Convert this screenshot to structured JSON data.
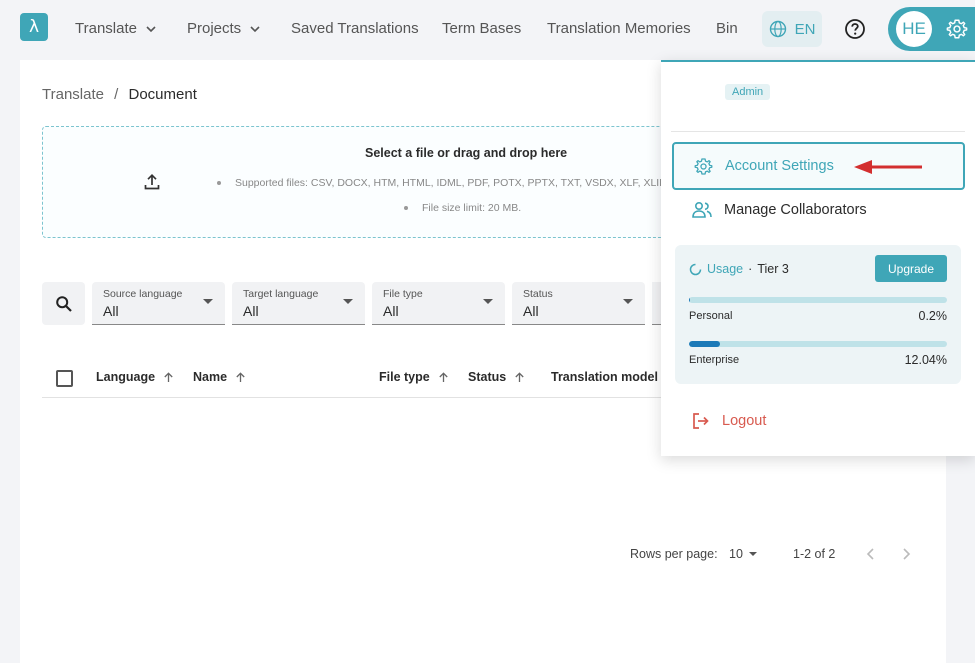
{
  "nav": {
    "items": [
      {
        "label": "Translate",
        "dropdown": true
      },
      {
        "label": "Projects",
        "dropdown": true
      },
      {
        "label": "Saved Translations"
      },
      {
        "label": "Term Bases"
      },
      {
        "label": "Translation Memories"
      },
      {
        "label": "Bin"
      }
    ],
    "language": "EN",
    "avatar_initials": "HE"
  },
  "breadcrumb": {
    "root": "Translate",
    "separator": "/",
    "current": "Document"
  },
  "dropzone": {
    "title": "Select a file or drag and drop here",
    "supported": "Supported files: CSV, DOCX, HTM, HTML, IDML, PDF, POTX, PPTX, TXT, VSDX, XLF, XLIFF,",
    "limit": "File size limit: 20 MB."
  },
  "filters": [
    {
      "label": "Source language",
      "value": "All"
    },
    {
      "label": "Target language",
      "value": "All"
    },
    {
      "label": "File type",
      "value": "All"
    },
    {
      "label": "Status",
      "value": "All"
    }
  ],
  "table": {
    "columns": [
      "Language",
      "Name",
      "File type",
      "Status",
      "Translation model"
    ]
  },
  "pagination": {
    "rows_label": "Rows per page:",
    "rows_value": "10",
    "range": "1-2 of 2"
  },
  "menu": {
    "role_badge": "Admin",
    "account_settings": "Account Settings",
    "manage_collaborators": "Manage Collaborators",
    "usage": {
      "label": "Usage",
      "separator": "·",
      "tier": "Tier 3",
      "upgrade": "Upgrade",
      "personal_label": "Personal",
      "personal_value": "0.2%",
      "personal_fraction": 0.002,
      "enterprise_label": "Enterprise",
      "enterprise_value": "12.04%",
      "enterprise_fraction": 0.1204
    },
    "logout": "Logout"
  },
  "colors": {
    "accent": "#3fa6b7",
    "logout": "#d85a4f",
    "arrow": "#d32f2f",
    "bar_fill": "#1c7ab8"
  }
}
